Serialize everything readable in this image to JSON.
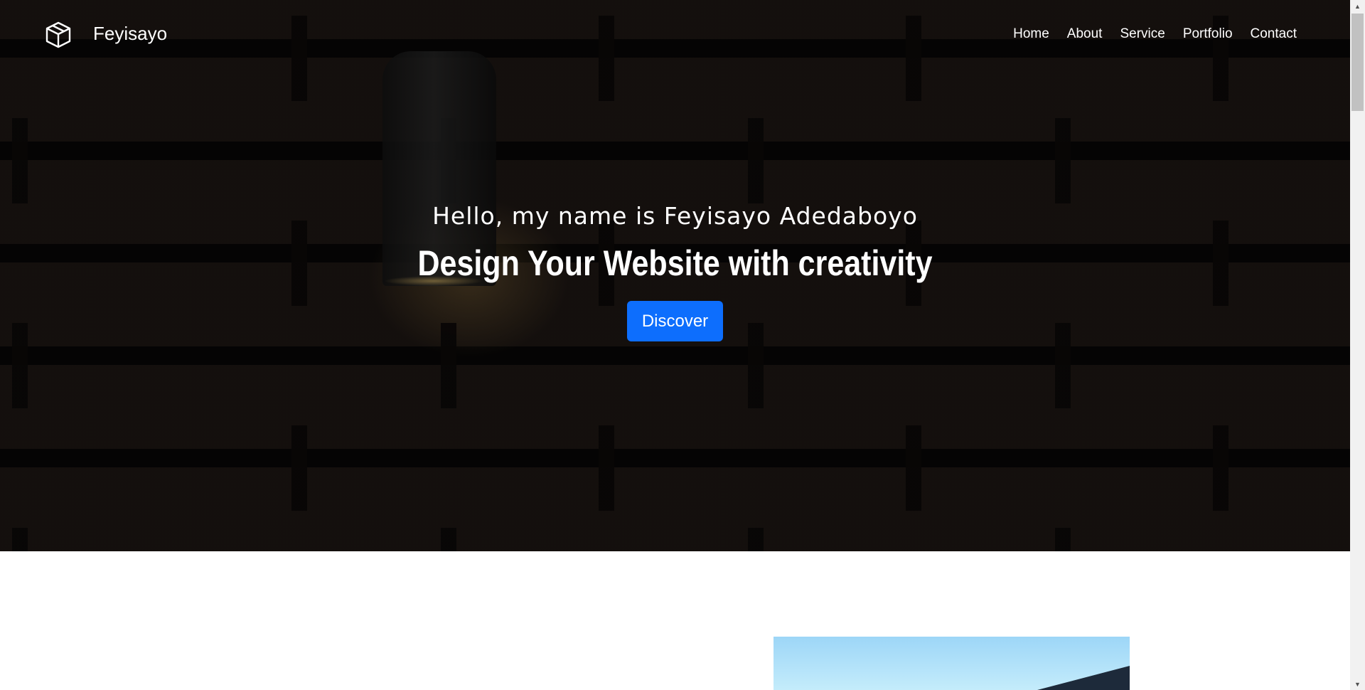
{
  "brand": {
    "name": "Feyisayo",
    "icon": "cube-icon"
  },
  "nav": {
    "items": [
      {
        "label": "Home"
      },
      {
        "label": "About"
      },
      {
        "label": "Service"
      },
      {
        "label": "Portfolio"
      },
      {
        "label": "Contact"
      }
    ]
  },
  "hero": {
    "subtitle": "Hello, my name is Feyisayo Adedaboyo",
    "title": "Design Your Website with creativity",
    "button_label": "Discover"
  },
  "colors": {
    "accent": "#0d6efd",
    "hero_overlay": "#000000",
    "text_on_dark": "#ffffff"
  }
}
